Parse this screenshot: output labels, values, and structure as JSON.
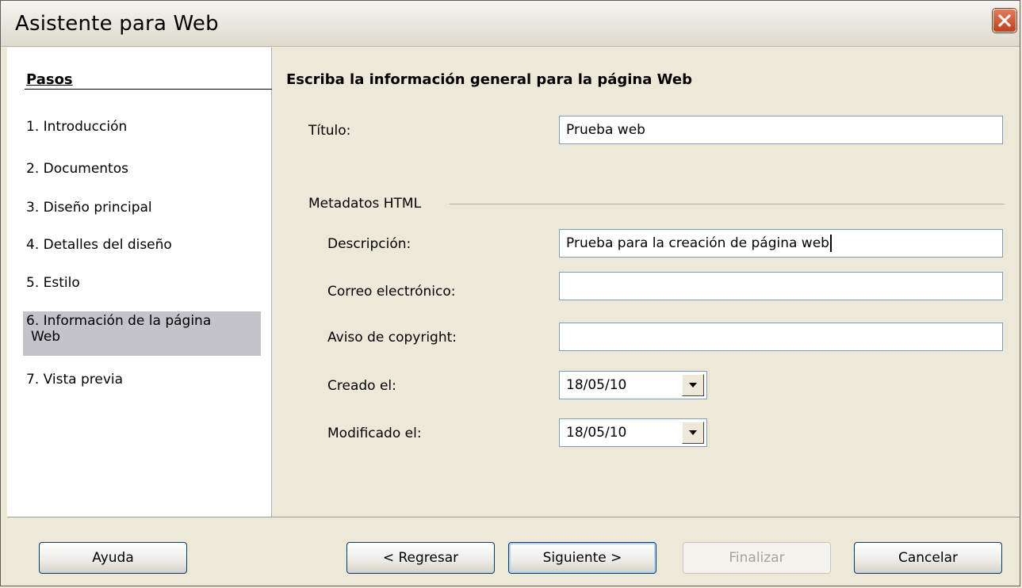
{
  "window": {
    "title": "Asistente para Web"
  },
  "steps": {
    "title": "Pasos",
    "items": [
      {
        "num": "1.",
        "label": "Introducción"
      },
      {
        "num": "2.",
        "label": "Documentos"
      },
      {
        "num": "3.",
        "label": "Diseño principal"
      },
      {
        "num": "4.",
        "label": "Detalles del diseño"
      },
      {
        "num": "5.",
        "label": "Estilo"
      },
      {
        "num": "6.",
        "label": "Información de la página",
        "label2": "Web",
        "active": true
      },
      {
        "num": "7.",
        "label": "Vista previa"
      }
    ]
  },
  "content": {
    "heading": "Escriba la información general para la página Web",
    "title_label": "Título:",
    "title_value": "Prueba web",
    "group_label": "Metadatos HTML",
    "description_label": "Descripción:",
    "description_value": "Prueba para la creación de página web",
    "email_label": "Correo electrónico:",
    "email_value": "",
    "copyright_label": "Aviso de copyright:",
    "copyright_value": "",
    "created_label": "Creado el:",
    "created_value": "18/05/10",
    "modified_label": "Modificado el:",
    "modified_value": "18/05/10"
  },
  "buttons": {
    "help": "Ayuda",
    "back": "< Regresar",
    "next": "Siguiente >",
    "finish": "Finalizar",
    "cancel": "Cancelar"
  },
  "colors": {
    "face": "#ece9d8",
    "active_step": "#c3c3c9",
    "field_border": "#7f9db9"
  }
}
